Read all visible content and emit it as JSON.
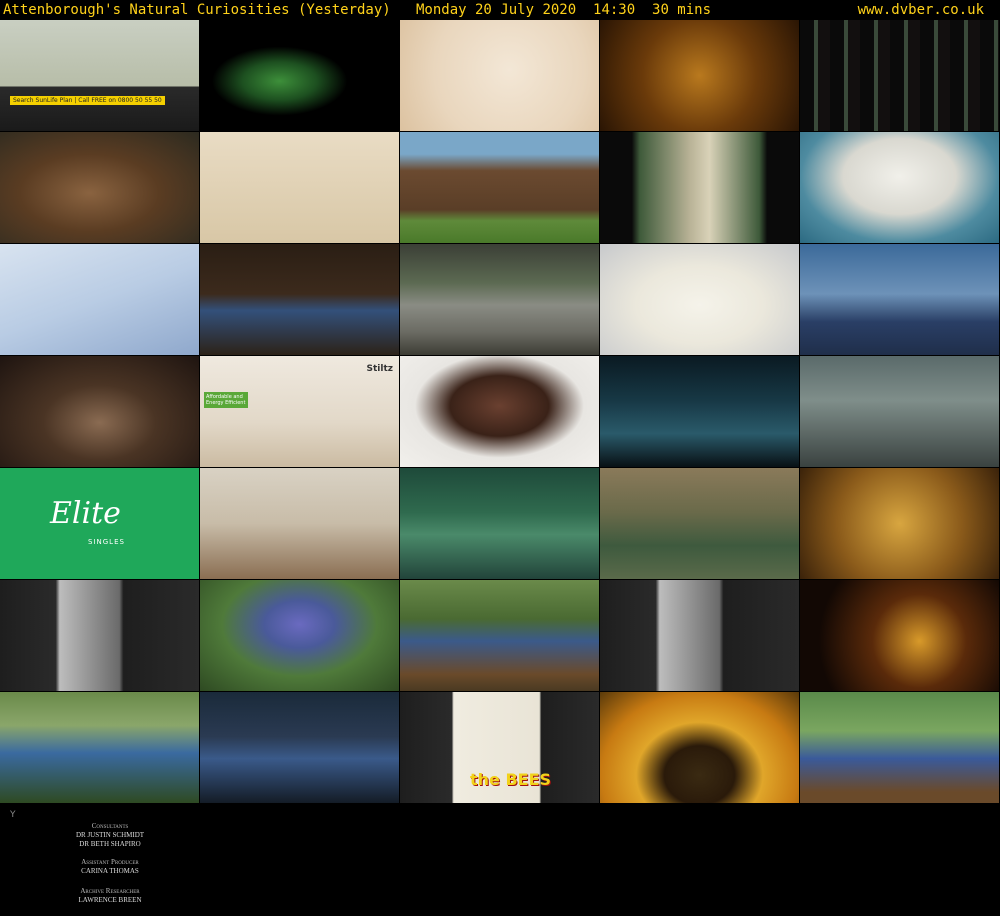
{
  "header": {
    "title": "Attenborough's Natural Curiosities (Yesterday)   Monday 20 July 2020  14:30  30 mins",
    "site": "www.dvber.co.uk"
  },
  "thumbs": [
    {
      "name": "thumb-presenter-ad",
      "bg": "linear-gradient(180deg,#c9cfc2 0%,#b7bda8 60%,#2a2a2a 60%,#1a1a1a 100%)"
    },
    {
      "name": "thumb-green-geometry",
      "bg": "radial-gradient(ellipse at 40% 55%,#3d8f3a 0%,#1d5020 22%,#000 40%)"
    },
    {
      "name": "thumb-shells-spiral",
      "bg": "radial-gradient(circle at 55% 45%,#f3e7d6 0%,#e9d6bd 60%,#dcc2a0 100%)"
    },
    {
      "name": "thumb-bees-closeup",
      "bg": "radial-gradient(circle at 50% 50%,#b9791e 0%,#6a3a0a 50%,#2a1504 100%)"
    },
    {
      "name": "thumb-dark-columns",
      "bg": "repeating-linear-gradient(90deg,#0a0a0a 0 14px,#3a4a3a 14px 18px,#120f0f 18px 30px)"
    },
    {
      "name": "thumb-bears-hugging",
      "bg": "radial-gradient(ellipse at 45% 55%,#8a6340 0%,#5a3c22 45%,#2c2a20 100%)"
    },
    {
      "name": "thumb-bear-family-chart",
      "bg": "linear-gradient(180deg,#e9dcc4 0%,#d8c7a6 100%)"
    },
    {
      "name": "thumb-grizzly-grass",
      "bg": "linear-gradient(180deg,#7aa7c8 0%,#7aa7c8 20%,#6b4a30 35%,#5a3e27 70%,#5f8a3a 80%,#4a7a2a 100%)"
    },
    {
      "name": "thumb-polar-bear-blend",
      "bg": "linear-gradient(90deg,#0a0a0a 0%,#0a0a0a 16%,#3e5a3a 20%,#b8b296 45%,#d9d2b8 55%,#3e5a3a 80%,#0a0a0a 84%)"
    },
    {
      "name": "thumb-polar-bear-swimming",
      "bg": "radial-gradient(ellipse at 50% 40%,#f1f0ea 0%,#d9d8d0 40%,#4e8ba0 70%,#2c6a82 100%)"
    },
    {
      "name": "thumb-snow-tracks",
      "bg": "linear-gradient(160deg,#d8e3f0 0%,#b9cce4 50%,#8fa8cc 100%)"
    },
    {
      "name": "thumb-attenborough-screen",
      "bg": "linear-gradient(180deg,#2a1e14 0%,#3c2a1c 45%,#33507a 60%,#2c2218 100%)"
    },
    {
      "name": "thumb-waterfall-bear",
      "bg": "linear-gradient(180deg,#3b3f36 0%,#5c6a52 35%,#8a8c84 55%,#6a6a62 80%,#3c3c34 100%)"
    },
    {
      "name": "thumb-polar-bear-face",
      "bg": "radial-gradient(ellipse at 50% 55%,#f5f3ea 0%,#ebe8dc 45%,#c7c9cc 100%)"
    },
    {
      "name": "thumb-bear-on-ice",
      "bg": "linear-gradient(180deg,#3b6a9a 0%,#6d92b8 45%,#2a3f66 70%,#1f2e4a 100%)"
    },
    {
      "name": "thumb-attenborough-portrait",
      "bg": "radial-gradient(ellipse at 50% 60%,#8a6b52 0%,#4a3424 40%,#1e1410 100%)"
    },
    {
      "name": "thumb-stiltz-lift-ad",
      "bg": "linear-gradient(180deg,#efe9df 0%,#e2d8c8 60%,#cbbba2 100%)"
    },
    {
      "name": "thumb-skincare-ad",
      "bg": "radial-gradient(ellipse at 50% 45%,#6a4030 0%,#3a2218 35%,#e8e6e2 60%,#f2f0ec 100%)"
    },
    {
      "name": "thumb-dark-teal-street",
      "bg": "linear-gradient(180deg,#0a1a22 0%,#173845 40%,#2a5a6a 70%,#081014 100%)"
    },
    {
      "name": "thumb-office-meeting",
      "bg": "linear-gradient(180deg,#5a6a6a 0%,#7f8e8a 40%,#3a4240 100%)"
    },
    {
      "name": "thumb-elite-singles-ad",
      "bg": "#1fa85a"
    },
    {
      "name": "thumb-picture-wall",
      "bg": "linear-gradient(180deg,#d9d2c4 0%,#c8bca8 50%,#8a6e52 100%)"
    },
    {
      "name": "thumb-green-machinery",
      "bg": "linear-gradient(180deg,#1e4a3a 0%,#2f6a4e 40%,#4a8a6a 60%,#22443a 100%)"
    },
    {
      "name": "thumb-bear-pool",
      "bg": "linear-gradient(180deg,#8a7a5a 0%,#6a6a4a 40%,#3e5a3e 70%,#5a6a4a 100%)"
    },
    {
      "name": "thumb-honeycomb-bees",
      "bg": "radial-gradient(circle at 50% 50%,#d8a640 0%,#8a5a1a 55%,#3a220a 100%)"
    },
    {
      "name": "thumb-scientist-chalkboard",
      "bg": "linear-gradient(90deg,#1e1e1e 0%,#2a2a2a 28%,#bdbdbd 30%,#6a6a6a 60%,#1e1e1e 62%,#2a2a2a 100%)"
    },
    {
      "name": "thumb-purple-flowers",
      "bg": "radial-gradient(ellipse at 50% 40%,#6a6ac0 0%,#4a5a9a 25%,#4f7a3a 55%,#2e4a22 100%)"
    },
    {
      "name": "thumb-attenborough-garden-table",
      "bg": "linear-gradient(180deg,#6a8a4a 0%,#4a6a32 35%,#3b5a8a 55%,#6a4a2a 85%,#4a3a22 100%)"
    },
    {
      "name": "thumb-scientist-chalkboard-2",
      "bg": "linear-gradient(90deg,#1e1e1e 0%,#2a2a2a 28%,#bdbdbd 30%,#6a6a6a 60%,#1e1e1e 62%,#2a2a2a 100%)"
    },
    {
      "name": "thumb-glowing-lights",
      "bg": "radial-gradient(circle at 60% 55%,#d89a2a 0%,#5a2a0a 35%,#120804 75%)"
    },
    {
      "name": "thumb-attenborough-glass-frame",
      "bg": "linear-gradient(180deg,#6a8a4a 0%,#8aa66a 30%,#3a6aa0 55%,#2e4a22 100%)"
    },
    {
      "name": "thumb-attenborough-museum",
      "bg": "linear-gradient(180deg,#1a2a3a 0%,#2a3a52 40%,#3a5a8a 60%,#141c26 100%)"
    },
    {
      "name": "thumb-bees-movie-poster",
      "bg": "linear-gradient(90deg,#1e1e1e 0%,#2a2a2a 26%,#f0ece0 27%,#e9e4d6 70%,#1e1e1e 71%,#2a2a2a 100%)"
    },
    {
      "name": "thumb-sunflower-bee",
      "bg": "radial-gradient(ellipse at 50% 75%,#3a2a12 0%,#2a1a0a 25%,#e0a62a 45%,#c77a12 70%,#5a3a0a 100%)"
    },
    {
      "name": "thumb-attenborough-beehive",
      "bg": "linear-gradient(180deg,#5a8a4a 0%,#7aa660 35%,#3a5a9a 60%,#6a4a2a 90%)"
    }
  ],
  "overlays": {
    "ad_search": "Search SunLife Plan | Call FREE on 0800 50 55 50",
    "stiltz_logo": "Stiltz",
    "stiltz_badge": "Affordable and Energy Efficient",
    "elite_brand": "Elite",
    "elite_sub": "SINGLES",
    "bees_poster_title": "the BEES"
  },
  "credits": {
    "logo": "Y",
    "consultants_role": "Consultants",
    "consultant1": "DR JUSTIN SCHMIDT",
    "consultant2": "DR BETH SHAPIRO",
    "producer_role": "Assistant Producer",
    "producer": "CARINA THOMAS",
    "archive_role": "Archive Researcher",
    "archive": "LAWRENCE BREEN"
  }
}
